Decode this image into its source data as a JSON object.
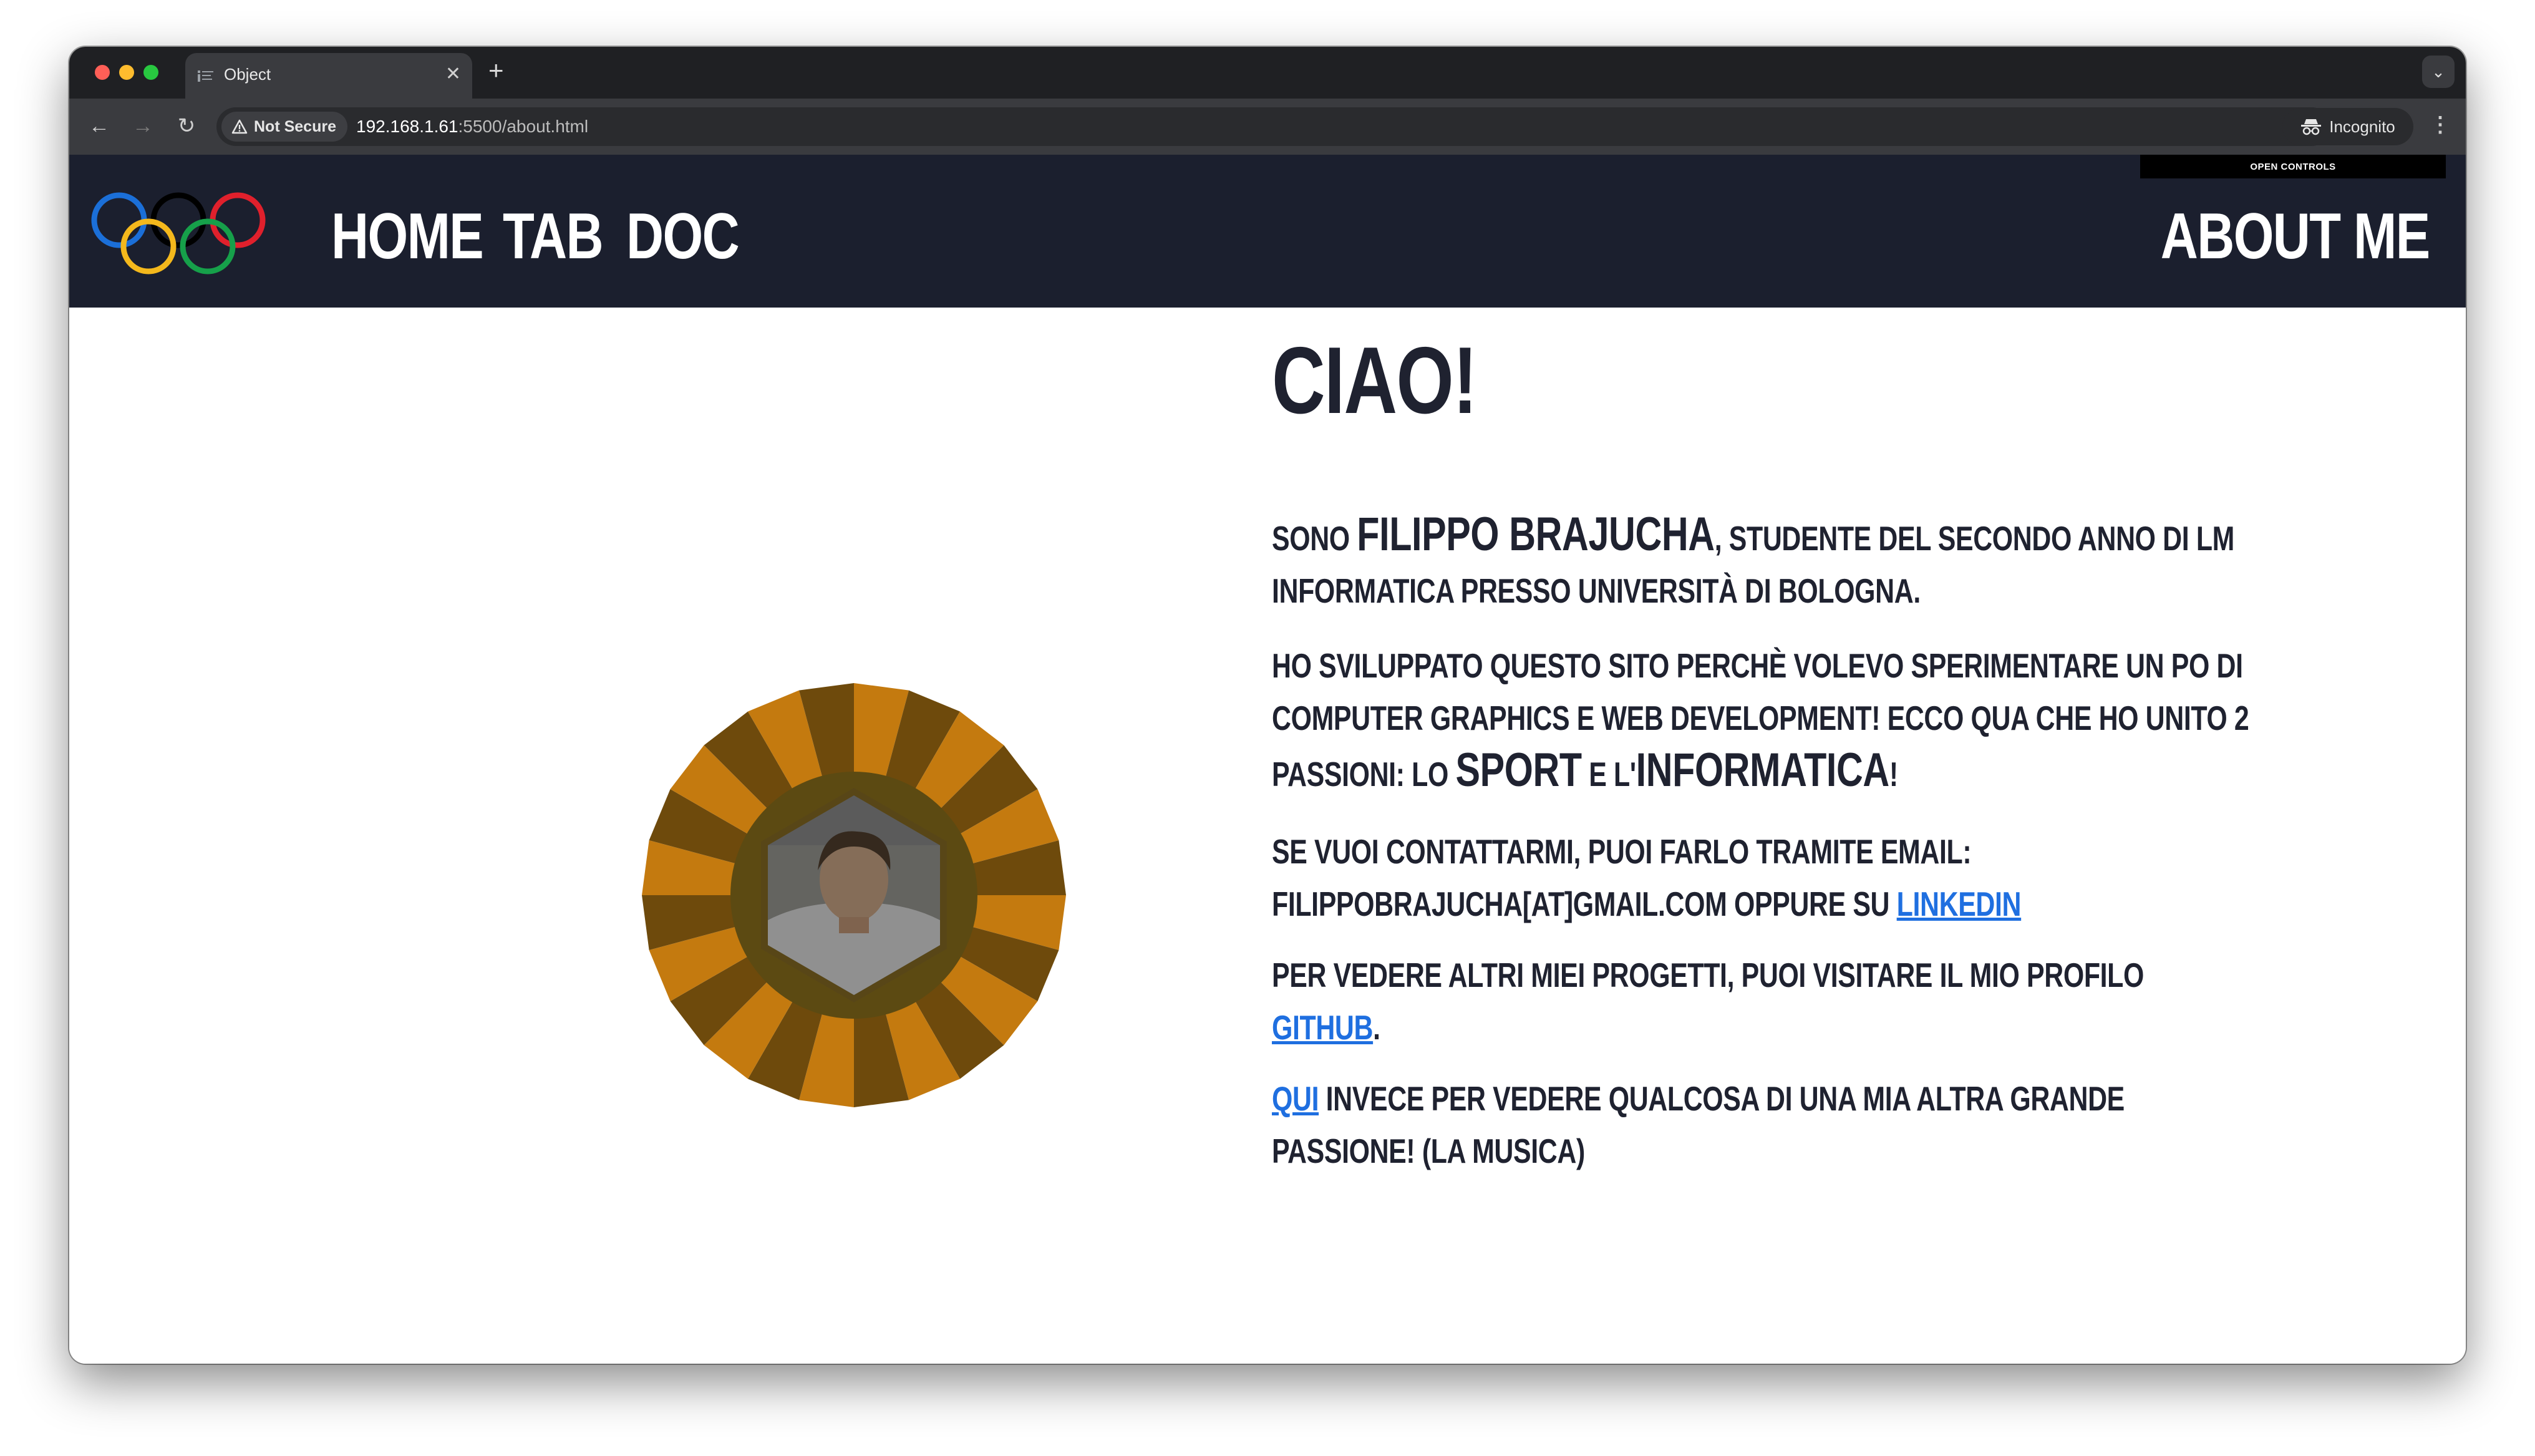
{
  "browser": {
    "tab_title": "Object",
    "security_label": "Not Secure",
    "url_host": "192.168.1.61",
    "url_path": ":5500/about.html",
    "incognito_label": "Incognito"
  },
  "site": {
    "nav": {
      "home": "HOME",
      "tab": "TAB",
      "doc": "DOC",
      "about": "ABOUT ME"
    },
    "open_controls": "OPEN CONTROLS"
  },
  "about": {
    "heading": "CIAO!",
    "p1": {
      "pre": "SONO ",
      "name": "FILIPPO BRAJUCHA",
      "line1_post": ", STUDENTE DEL SECONDO ANNO DI LM",
      "line2": "INFORMATICA PRESSO UNIVERSITÀ DI BOLOGNA."
    },
    "p2": {
      "line1": "HO SVILUPPATO QUESTO SITO PERCHÈ VOLEVO SPERIMENTARE UN PO DI",
      "line2": "COMPUTER GRAPHICS E WEB DEVELOPMENT! ECCO QUA CHE HO UNITO 2",
      "line3_pre": "PASSIONI: LO ",
      "sport": "SPORT",
      "mid": " E L'",
      "informatica": "INFORMATICA",
      "end": "!"
    },
    "p3": {
      "line1": "SE VUOI CONTATTARMI, PUOI FARLO TRAMITE EMAIL:",
      "line2_pre": "FILIPPOBRAJUCHA[AT]GMAIL.COM OPPURE SU ",
      "linkedin": "LINKEDIN"
    },
    "p4": {
      "line1": "PER VEDERE ALTRI MIEI PROGETTI, PUOI VISITARE IL MIO PROFILO",
      "github": "GITHUB",
      "end": "."
    },
    "p5": {
      "qui": "QUI",
      "line1_post": " INVECE PER VEDERE QUALCOSA DI UNA MIA ALTRA GRANDE",
      "line2": "PASSIONE! (LA MUSICA)"
    }
  },
  "colors": {
    "header_bg": "#1b1f2e",
    "link": "#1f6fe0",
    "text": "#1f2230",
    "medal_gold": "#c47a0f",
    "medal_dark": "#6e4a0c"
  }
}
